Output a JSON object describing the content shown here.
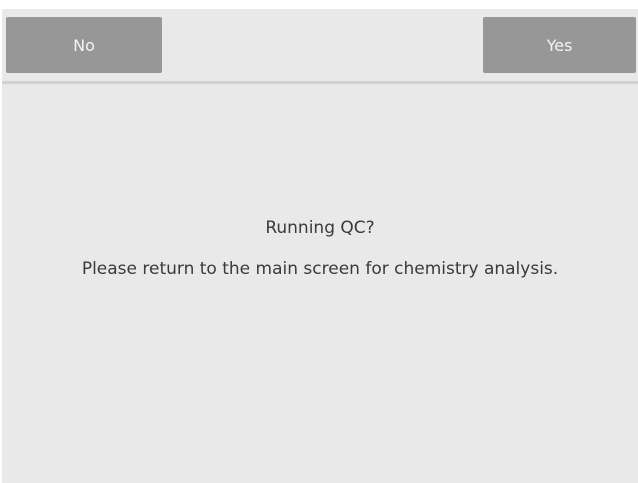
{
  "dialog": {
    "no_label": "No",
    "yes_label": "Yes",
    "title": "Running QC?",
    "message": "Please return to the main screen for chemistry analysis."
  },
  "colors": {
    "background": "#e9e9e9",
    "button": "#979797",
    "button_text": "#f3f3f3",
    "text": "#3a3a3a"
  }
}
